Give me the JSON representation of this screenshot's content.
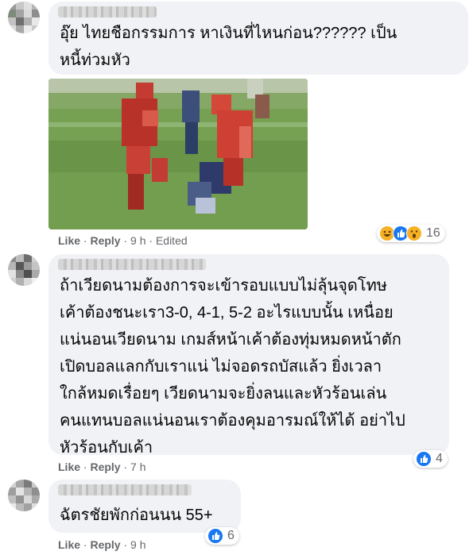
{
  "comments": [
    {
      "text_lines": [
        "อุ๊ย ไทยชือกรรมการ หาเงินที่ไหนก่อน?????? เป็น",
        "หนี้ท่วมหัว"
      ],
      "actions": {
        "like": "Like",
        "reply": "Reply",
        "meta": "· 9 h · Edited"
      },
      "reaction_count": "16",
      "reaction_icons": [
        "haha-icon",
        "like-icon",
        "wow-icon"
      ]
    },
    {
      "text_lines": [
        "ถ้าเวียดนามต้องการจะเข้ารอบแบบไม่ลุ้นจุดโทษ",
        "เค้าต้องชนะเรา3-0, 4-1, 5-2 อะไรแบบนั้น เหนื่อย",
        "แน่นอนเวียดนาม เกมส์หน้าเค้าต้องทุ่มหมดหน้าตัก",
        "เปิดบอลแลกกับเราแน่ ไม่จอดรถบัสแล้ว ยิ่งเวลา",
        "ใกล้หมดเรื่อยๆ เวียดนามจะยิ่งลนและหัวร้อนเล่น",
        "คนแทนบอลแน่นอนเราต้องคุมอารมณ์ให้ได้ อย่าไป",
        "หัวร้อนกับเค้า"
      ],
      "actions": {
        "like": "Like",
        "reply": "Reply",
        "meta": "· 7 h"
      },
      "reaction_count": "4",
      "reaction_icons": [
        "like-icon"
      ]
    },
    {
      "text_lines": [
        "ฉัตรชัยพักก่อนนน 55+"
      ],
      "actions": {
        "like": "Like",
        "reply": "Reply",
        "meta": "· 9 h"
      },
      "reaction_count": "6",
      "reaction_icons": [
        "like-icon"
      ]
    }
  ],
  "colors": {
    "bubble": "#f0f2f5",
    "text": "#050505",
    "meta": "#65676b",
    "like_blue": "#1877f2",
    "haha_yellow": "#f7b125"
  }
}
